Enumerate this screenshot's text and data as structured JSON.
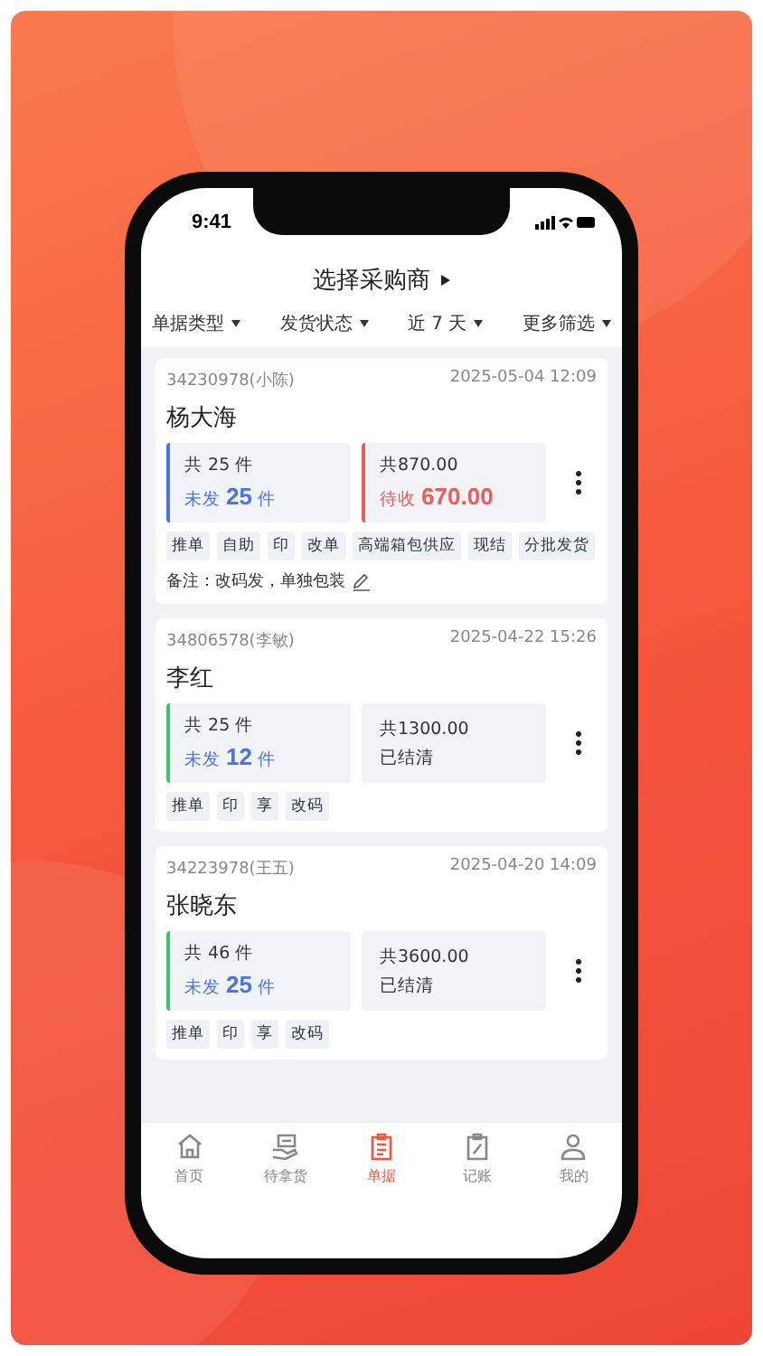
{
  "status_bar": {
    "time": "9:41"
  },
  "header": {
    "title": "选择采购商"
  },
  "filters": [
    {
      "label": "单据类型"
    },
    {
      "label": "发货状态"
    },
    {
      "label": "近 7 天"
    },
    {
      "label": "更多筛选"
    }
  ],
  "orders": [
    {
      "id": "34230978(小陈)",
      "date": "2025-05-04 12:09",
      "name": "杨大海",
      "qty": {
        "color": "#4a74e0",
        "total": "共 25 件",
        "unsent_label": "未发",
        "unsent_value": "25",
        "unsent_unit": "件"
      },
      "money": {
        "kind": "pending",
        "total": "共870.00",
        "label": "待收",
        "value": "670.00"
      },
      "tags": [
        "推单",
        "自助",
        "印",
        "改单",
        "高端箱包供应",
        "现结",
        "分批发货"
      ],
      "note": "备注：改码发，单独包装"
    },
    {
      "id": "34806578(李敏)",
      "date": "2025-04-22 15:26",
      "name": "李红",
      "qty": {
        "color": "#3cc46a",
        "total": "共 25 件",
        "unsent_label": "未发",
        "unsent_value": "12",
        "unsent_unit": "件"
      },
      "money": {
        "kind": "settled",
        "total": "共1300.00",
        "label": "已结清"
      },
      "tags": [
        "推单",
        "印",
        "享",
        "改码"
      ]
    },
    {
      "id": "34223978(王五)",
      "date": "2025-04-20 14:09",
      "name": "张晓东",
      "qty": {
        "color": "#3cc46a",
        "total": "共 46 件",
        "unsent_label": "未发",
        "unsent_value": "25",
        "unsent_unit": "件"
      },
      "money": {
        "kind": "settled",
        "total": "共3600.00",
        "label": "已结清"
      },
      "tags": [
        "推单",
        "印",
        "享",
        "改码"
      ]
    }
  ],
  "tabs": [
    {
      "label": "首页",
      "selected": false
    },
    {
      "label": "待拿货",
      "selected": false
    },
    {
      "label": "单据",
      "selected": true
    },
    {
      "label": "记账",
      "selected": false
    },
    {
      "label": "我的",
      "selected": false
    }
  ]
}
